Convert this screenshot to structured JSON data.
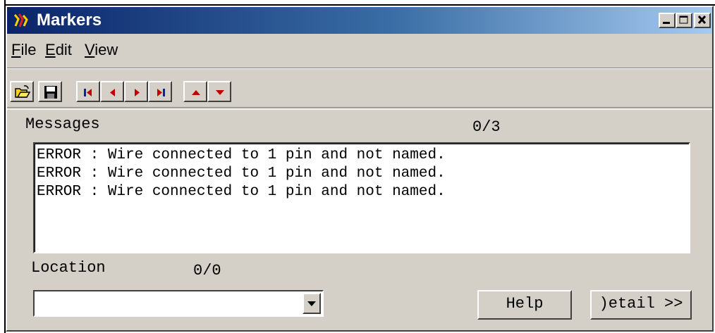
{
  "window": {
    "title": "Markers"
  },
  "menu": {
    "file": {
      "mnemonic": "F",
      "rest": "ile"
    },
    "edit": {
      "mnemonic": "E",
      "rest": "dit"
    },
    "view": {
      "mnemonic": "V",
      "rest": "iew"
    }
  },
  "messages": {
    "label": "Messages",
    "counter": "0/3",
    "items": [
      "ERROR : Wire connected to 1 pin and not named.",
      "ERROR : Wire connected to 1 pin and not named.",
      "ERROR : Wire connected to 1 pin and not named."
    ]
  },
  "location": {
    "label": "Location",
    "counter": "0/0",
    "value": ""
  },
  "buttons": {
    "help": "Help",
    "detail": ")etail >>"
  },
  "colors": {
    "face": "#d4d0c8",
    "title_start": "#0a246a",
    "title_end": "#a6caf0",
    "nav_red": "#c00000",
    "nav_blue": "#1020a0"
  }
}
